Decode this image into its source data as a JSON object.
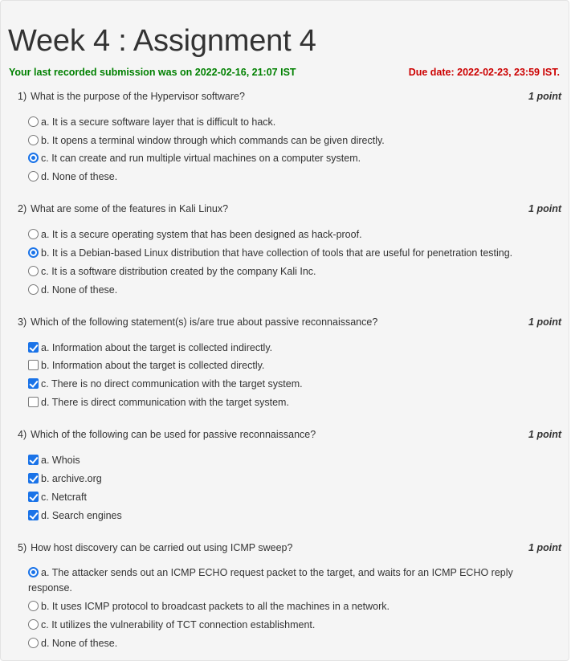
{
  "header": {
    "title": "Week 4 : Assignment 4",
    "submission": "Your last recorded submission was on 2022-02-16, 21:07 IST",
    "due_date": "Due date: 2022-02-23, 23:59 IST."
  },
  "colors": {
    "submission": "#008000",
    "due_date": "#cc0000",
    "accent": "#1a73e8"
  },
  "questions": [
    {
      "number": "1)",
      "text": "What is the purpose of the Hypervisor software?",
      "points": "1 point",
      "type": "radio",
      "options": [
        {
          "label": "a. It is a secure software layer that is difficult to hack.",
          "selected": false
        },
        {
          "label": "b. It opens a terminal window through which commands can be given directly.",
          "selected": false
        },
        {
          "label": "c. It can create and run multiple virtual machines on a computer system.",
          "selected": true
        },
        {
          "label": "d. None of these.",
          "selected": false
        }
      ]
    },
    {
      "number": "2)",
      "text": "What are some of the features in Kali Linux?",
      "points": "1 point",
      "type": "radio",
      "options": [
        {
          "label": "a. It is a secure operating system that has been designed as hack-proof.",
          "selected": false
        },
        {
          "label": "b. It is a Debian-based Linux distribution that have collection of tools that are useful for penetration testing.",
          "selected": true
        },
        {
          "label": "c. It is a software distribution created by the company Kali Inc.",
          "selected": false
        },
        {
          "label": "d. None of these.",
          "selected": false
        }
      ]
    },
    {
      "number": "3)",
      "text": "Which of the following statement(s) is/are true about passive reconnaissance?",
      "points": "1 point",
      "type": "checkbox",
      "options": [
        {
          "label": "a. Information about the target is collected indirectly.",
          "selected": true
        },
        {
          "label": "b. Information about the target is collected directly.",
          "selected": false
        },
        {
          "label": "c. There is no direct communication with the target system.",
          "selected": true
        },
        {
          "label": "d. There is direct communication with the target system.",
          "selected": false
        }
      ]
    },
    {
      "number": "4)",
      "text": "Which of the following can be used for passive reconnaissance?",
      "points": "1 point",
      "type": "checkbox",
      "options": [
        {
          "label": "a. Whois",
          "selected": true
        },
        {
          "label": "b. archive.org",
          "selected": true
        },
        {
          "label": "c. Netcraft",
          "selected": true
        },
        {
          "label": "d. Search engines",
          "selected": true
        }
      ]
    },
    {
      "number": "5)",
      "text": "How host discovery can be carried out using ICMP sweep?",
      "points": "1 point",
      "type": "radio",
      "options": [
        {
          "label": "a. The attacker sends out an ICMP ECHO request packet to the target, and waits for an ICMP ECHO reply response.",
          "selected": true
        },
        {
          "label": "b. It uses ICMP protocol to broadcast packets to all the machines in a network.",
          "selected": false
        },
        {
          "label": "c. It utilizes the vulnerability of TCT connection establishment.",
          "selected": false
        },
        {
          "label": "d. None of these.",
          "selected": false
        }
      ]
    }
  ]
}
